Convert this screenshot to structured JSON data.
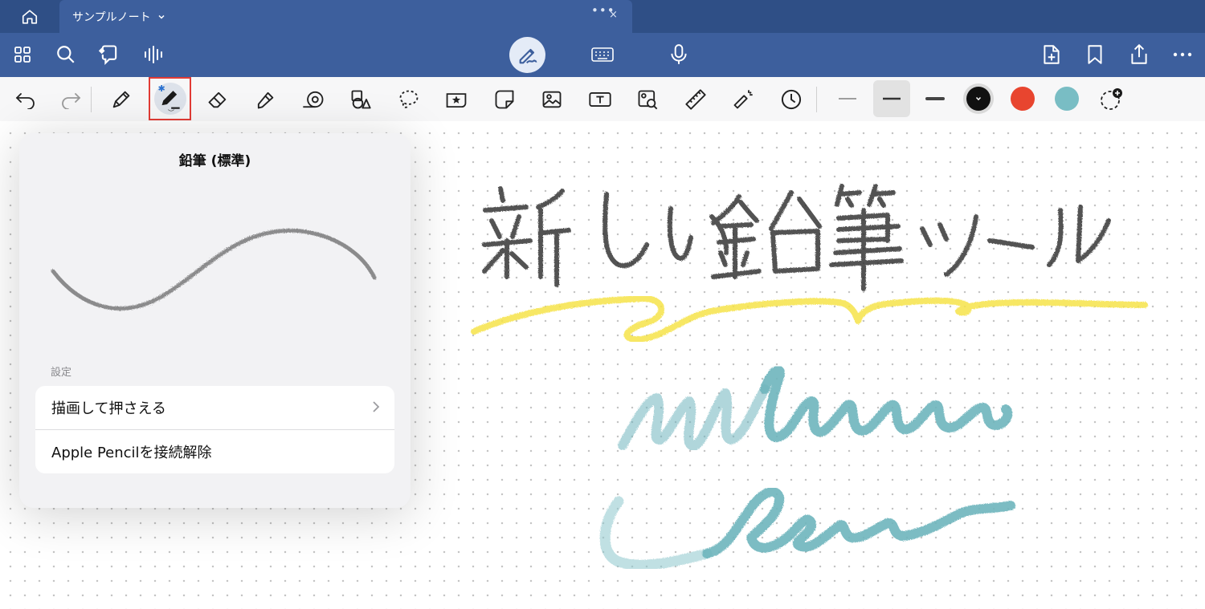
{
  "tab": {
    "title": "サンプルノート",
    "dots": "•••",
    "close": "×"
  },
  "header": {
    "left_icons": [
      "grid-icon",
      "search-icon",
      "ai-sparkle-icon",
      "audio-waveform-icon"
    ],
    "mode_icons": [
      "handwriting-mode-icon",
      "keyboard-icon",
      "microphone-icon"
    ],
    "right_icons": [
      "add-page-icon",
      "bookmark-icon",
      "share-icon",
      "more-icon"
    ]
  },
  "toolbar": {
    "tools": [
      "undo",
      "redo",
      "fountain-pen",
      "pencil",
      "eraser",
      "highlighter",
      "tape",
      "shapes",
      "lasso",
      "sticker",
      "sticky-note",
      "image",
      "text-box",
      "camera-scan",
      "ruler",
      "laser-pointer",
      "history"
    ],
    "selected_tool": "pencil",
    "stroke_widths": [
      "thin",
      "medium",
      "thick"
    ],
    "selected_width": "medium",
    "colors": [
      "#111111",
      "#e8452f",
      "#79bdc4"
    ],
    "selected_color": "#111111"
  },
  "popover": {
    "title": "鉛筆 (標準)",
    "section_label": "設定",
    "rows": [
      {
        "label": "描画して押さえる",
        "has_chevron": true
      },
      {
        "label": "Apple Pencilを接続解除",
        "has_chevron": false
      }
    ]
  },
  "canvas": {
    "handwriting_text": "新しい鉛筆ツール",
    "stroke_colors": {
      "pencil": "#2b2b2b",
      "highlight": "#f7e44d",
      "teal": "#6fb5bd"
    }
  }
}
